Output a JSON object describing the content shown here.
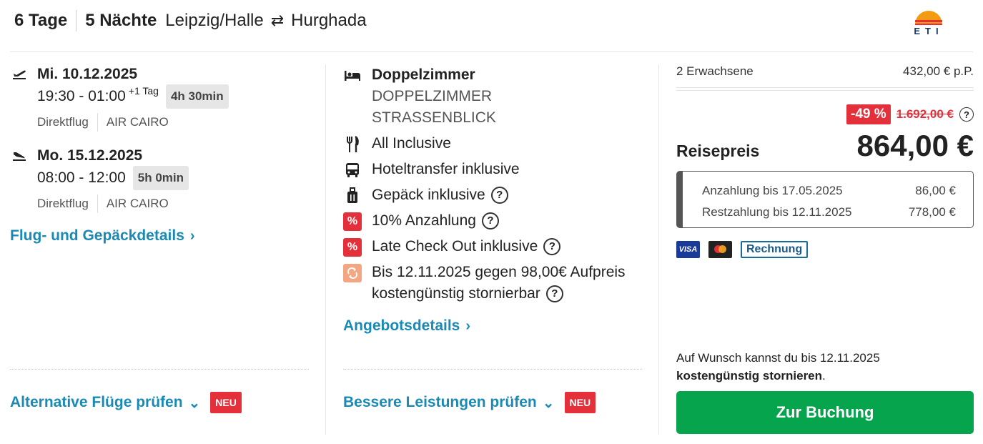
{
  "header": {
    "days": "6 Tage",
    "nights": "5 Nächte",
    "origin": "Leipzig/Halle",
    "destination": "Hurghada",
    "logo_text": "ETI"
  },
  "flights": [
    {
      "date": "Mi. 10.12.2025",
      "times": "19:30 - 01:00",
      "plus_day": "+1 Tag",
      "duration": "4h 30min",
      "type": "Direktflug",
      "airline": "AIR CAIRO"
    },
    {
      "date": "Mo. 15.12.2025",
      "times": "08:00 - 12:00",
      "plus_day": "",
      "duration": "5h 0min",
      "type": "Direktflug",
      "airline": "AIR CAIRO"
    }
  ],
  "flight_details_link": "Flug- und Gepäckdetails",
  "alt_flights_link": "Alternative Flüge prüfen",
  "neu_badge": "NEU",
  "room": {
    "title": "Doppelzimmer",
    "line1": "DOPPELZIMMER",
    "line2": "STRASSENBLICK"
  },
  "features": {
    "board": "All Inclusive",
    "transfer": "Hoteltransfer inklusive",
    "luggage": "Gepäck inklusive",
    "deposit": "10% Anzahlung",
    "checkout": "Late Check Out inklusive",
    "cancel_line1": "Bis 12.11.2025 gegen 98,00€ Aufpreis",
    "cancel_line2": "kostengünstig stornierbar",
    "pct_symbol": "%"
  },
  "offer_details_link": "Angebotsdetails",
  "better_services_link": "Bessere Leistungen prüfen",
  "price": {
    "travellers": "2 Erwachsene",
    "per_person": "432,00 € p.P.",
    "discount": "-49 %",
    "old_price": "1.692,00 €",
    "label": "Reisepreis",
    "total": "864,00 €",
    "deposit_label": "Anzahlung bis 17.05.2025",
    "deposit_value": "86,00 €",
    "rest_label": "Restzahlung bis 12.11.2025",
    "rest_value": "778,00 €"
  },
  "payment": {
    "visa": "VISA",
    "invoice": "Rechnung"
  },
  "note": {
    "line1": "Auf Wunsch kannst du bis 12.11.2025",
    "bold": "kostengünstig stornieren",
    "period": "."
  },
  "cta": "Zur Buchung",
  "qm": "?"
}
